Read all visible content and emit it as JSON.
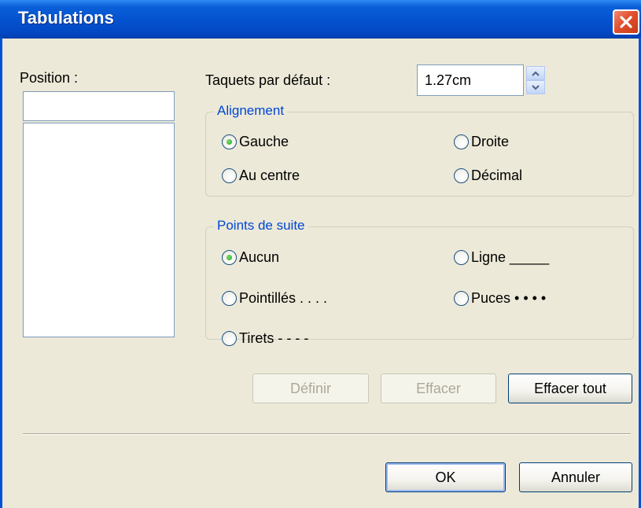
{
  "window": {
    "title": "Tabulations",
    "close_icon": "close-icon",
    "colors": {
      "titlebar": "#0453d0",
      "close": "#e2502e",
      "background": "#ece9d8",
      "legend": "#0046d5"
    }
  },
  "position": {
    "label": "Position :",
    "value": "",
    "list_items": []
  },
  "default_tabs": {
    "label": "Taquets par défaut :",
    "value": "1.27cm",
    "icon": "spinner-arrows-icon"
  },
  "alignment": {
    "legend": "Alignement",
    "options": [
      {
        "label": "Gauche",
        "checked": true
      },
      {
        "label": "Droite",
        "checked": false
      },
      {
        "label": "Au centre",
        "checked": false
      },
      {
        "label": "Décimal",
        "checked": false
      }
    ]
  },
  "leaders": {
    "legend": "Points de suite",
    "options": [
      {
        "label": "Aucun",
        "checked": true
      },
      {
        "label": "Ligne _____",
        "checked": false
      },
      {
        "label": "Pointillés . . . .",
        "checked": false
      },
      {
        "label": "Puces • • • •",
        "checked": false
      },
      {
        "label": "Tirets - - - -",
        "checked": false
      }
    ]
  },
  "buttons": {
    "define": "Définir",
    "clear": "Effacer",
    "clear_all": "Effacer tout",
    "ok": "OK",
    "cancel": "Annuler"
  }
}
